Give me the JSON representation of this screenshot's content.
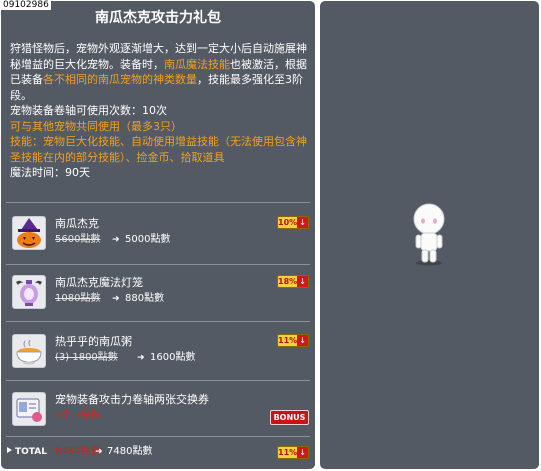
{
  "package": {
    "code": "09102986",
    "title": "南瓜杰克攻击力礼包",
    "description": {
      "p1": "狩猎怪物后，宠物外观逐渐增大，达到一定大小后自动施展神秘增益的巨大化宠物。装备时，",
      "p1_hl": "南瓜魔法技能",
      "p2": "也被激活，根据已装备",
      "p2_hl": "各不相同的南瓜宠物的神类数量",
      "p3": "，技能最多强化至3阶段。",
      "p4": "宠物装备卷轴可使用次数：10次",
      "p5": "可与其他宠物共同使用（最多3只）",
      "p6": "技能：宠物巨大化技能、自动使用增益技能（无法使用包含神圣技能在内的部分技能）、捡金币、拾取道具",
      "p7": "魔法时间：90天"
    }
  },
  "items": [
    {
      "name": "南瓜杰克",
      "old_price": "5600點數",
      "new_price": "5000點數",
      "discount": "10%",
      "icon": "pumpkin-jack-icon"
    },
    {
      "name": "南瓜杰克魔法灯笼",
      "old_price": "1080點數",
      "new_price": "880點數",
      "discount": "18%",
      "icon": "magic-lantern-icon"
    },
    {
      "name": "热乎乎的南瓜粥",
      "old_price": "(3) 1800點數",
      "new_price": "1600點數",
      "discount": "11%",
      "icon": "pumpkin-porridge-icon"
    },
    {
      "name": "宠物装备攻击力卷轴两张交换券",
      "note": "3个 1點數",
      "bonus": "BONUS",
      "icon": "scroll-voucher-icon"
    }
  ],
  "total": {
    "label": "TOTAL",
    "old_price": "8480點數",
    "new_price": "7480點數",
    "discount": "11%"
  },
  "arrow_glyph": "➜",
  "down_glyph": "↓",
  "colors": {
    "panel": "#545a63",
    "highlight": "#f0a020",
    "discount_bg": "#f4d23c",
    "bonus_bg": "#c81414"
  }
}
